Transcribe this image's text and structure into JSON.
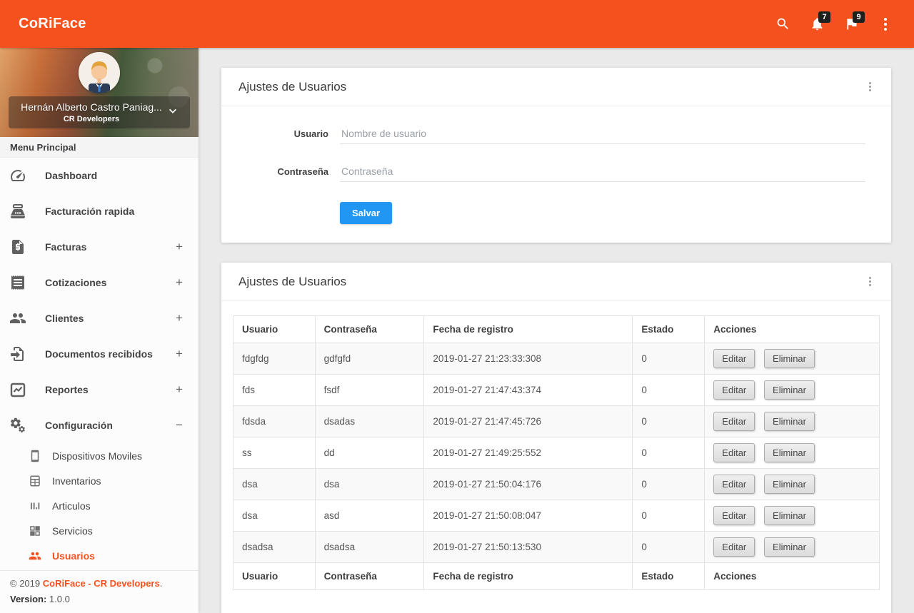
{
  "colors": {
    "accent": "#f4511e",
    "primary_button": "#2196f3",
    "badge_bg": "#1f1f1f"
  },
  "header": {
    "brand": "CoRiFace",
    "notifications_count": "7",
    "flags_count": "9"
  },
  "sidebar": {
    "profile": {
      "name": "Hernán Alberto Castro Paniag...",
      "org": "CR Developers"
    },
    "section_label": "Menu Principal",
    "items": [
      {
        "label": "Dashboard",
        "toggle": ""
      },
      {
        "label": "Facturación rapida",
        "toggle": ""
      },
      {
        "label": "Facturas",
        "toggle": "+"
      },
      {
        "label": "Cotizaciones",
        "toggle": "+"
      },
      {
        "label": "Clientes",
        "toggle": "+"
      },
      {
        "label": "Documentos recibidos",
        "toggle": "+"
      },
      {
        "label": "Reportes",
        "toggle": "+"
      },
      {
        "label": "Configuración",
        "toggle": "−"
      }
    ],
    "subitems": [
      {
        "label": "Dispositivos Moviles"
      },
      {
        "label": "Inventarios"
      },
      {
        "label": "Articulos"
      },
      {
        "label": "Servicios"
      },
      {
        "label": "Usuarios"
      }
    ],
    "footer": {
      "copyright_prefix": "© 2019 ",
      "link": "CoRiFace - CR Developers",
      "suffix": ".",
      "version_label": "Version:",
      "version": " 1.0.0"
    }
  },
  "form_card": {
    "title": "Ajustes de Usuarios",
    "fields": [
      {
        "label": "Usuario",
        "placeholder": "Nombre de usuario",
        "value": ""
      },
      {
        "label": "Contraseña",
        "placeholder": "Contraseña",
        "value": ""
      }
    ],
    "save_label": "Salvar"
  },
  "table_card": {
    "title": "Ajustes de Usuarios",
    "columns": [
      "Usuario",
      "Contraseña",
      "Fecha de registro",
      "Estado",
      "Acciones"
    ],
    "actions": {
      "edit": "Editar",
      "delete": "Eliminar"
    },
    "rows": [
      {
        "usuario": "fdgfdg",
        "contrasena": "gdfgfd",
        "fecha": "2019-01-27 21:23:33:308",
        "estado": "0"
      },
      {
        "usuario": "fds",
        "contrasena": "fsdf",
        "fecha": "2019-01-27 21:47:43:374",
        "estado": "0"
      },
      {
        "usuario": "fdsda",
        "contrasena": "dsadas",
        "fecha": "2019-01-27 21:47:45:726",
        "estado": "0"
      },
      {
        "usuario": "ss",
        "contrasena": "dd",
        "fecha": "2019-01-27 21:49:25:552",
        "estado": "0"
      },
      {
        "usuario": "dsa",
        "contrasena": "dsa",
        "fecha": "2019-01-27 21:50:04:176",
        "estado": "0"
      },
      {
        "usuario": "dsa",
        "contrasena": "asd",
        "fecha": "2019-01-27 21:50:08:047",
        "estado": "0"
      },
      {
        "usuario": "dsadsa",
        "contrasena": "dsadsa",
        "fecha": "2019-01-27 21:50:13:530",
        "estado": "0"
      }
    ]
  }
}
